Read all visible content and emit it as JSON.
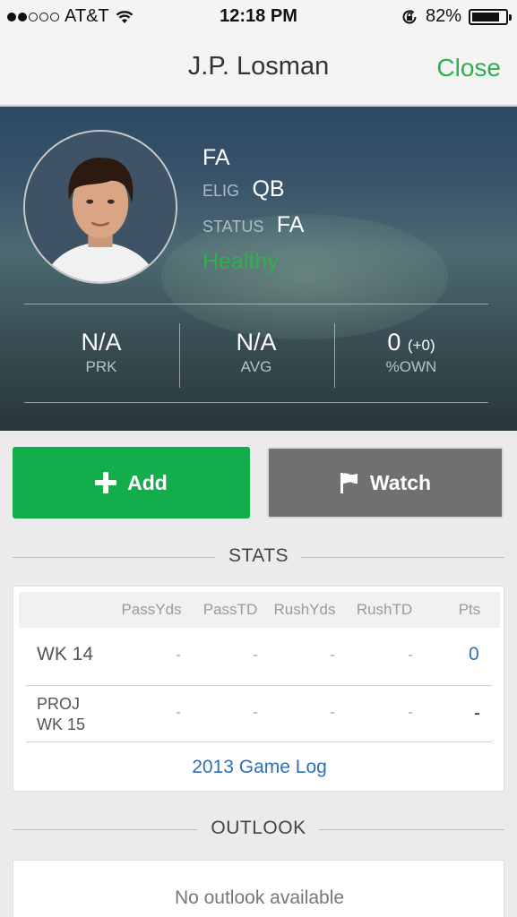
{
  "status_bar": {
    "carrier": "AT&T",
    "time": "12:18 PM",
    "battery": "82%",
    "battery_level": 0.82
  },
  "nav": {
    "title": "J.P. Losman",
    "close_label": "Close"
  },
  "player": {
    "team": "FA",
    "elig_label": "ELIG",
    "elig_value": "QB",
    "status_label": "STATUS",
    "status_value": "FA",
    "health": "Healthy",
    "stats": [
      {
        "value": "N/A",
        "caption": "PRK"
      },
      {
        "value": "N/A",
        "caption": "AVG"
      },
      {
        "value": "0",
        "change": "(+0)",
        "caption": "%OWN"
      }
    ]
  },
  "actions": {
    "add_label": "Add",
    "watch_label": "Watch"
  },
  "stats_section": {
    "title": "STATS",
    "columns": [
      "PassYds",
      "PassTD",
      "RushYds",
      "RushTD",
      "Pts"
    ],
    "rows": [
      {
        "label": "WK 14",
        "cells": [
          "-",
          "-",
          "-",
          "-"
        ],
        "pts": "0"
      },
      {
        "label_line1": "PROJ",
        "label_line2": "WK 15",
        "cells": [
          "-",
          "-",
          "-",
          "-"
        ],
        "pts": "-"
      }
    ],
    "game_log_link": "2013 Game Log"
  },
  "outlook_section": {
    "title": "OUTLOOK",
    "empty_text": "No outlook available"
  },
  "colors": {
    "brand_green": "#13ae4b",
    "link_blue": "#2f6fb8",
    "watch_gray": "#707070"
  }
}
